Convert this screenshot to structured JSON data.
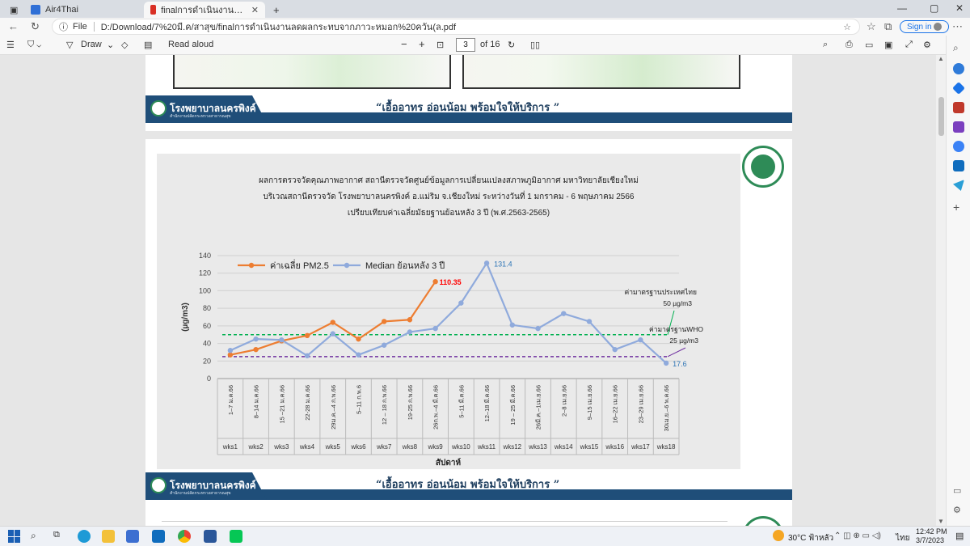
{
  "browser": {
    "tabs": [
      {
        "label": "Air4Thai",
        "active": false
      },
      {
        "label": "finalการดำเนินงานลดผลกระทบจากก",
        "active": true
      }
    ],
    "new_tab": "+",
    "address_prefix": "File",
    "url": "D:/Download/7%20มี.ค/สาสุข/finalการดำเนินงานลดผลกระทบจากภาวะหมอก%20ควัน(ล.pdf",
    "signin": "Sign in",
    "window_controls": [
      "—",
      "▢",
      "✕"
    ]
  },
  "pdf_toolbar": {
    "draw": "Draw",
    "read_aloud": "Read aloud",
    "zoom_out": "−",
    "zoom_in": "+",
    "page_current": "3",
    "page_total": "of 16"
  },
  "page_banner": {
    "hospital": "โรงพยาบาลนครพิงค์",
    "hospital_sub": "สำนักงานปลัดกระทรวงสาธารณสุข",
    "slogan": "“เอื้ออาทร อ่อนน้อม พร้อมใจให้บริการ ”"
  },
  "chart_titles": {
    "line1": "ผลการตรวจวัดคุณภาพอากาศ สถานีตรวจวัดศูนย์ข้อมูลการเปลี่ยนแปลงสภาพภูมิอากาศ มหาวิทยาลัยเชียงใหม่",
    "line2": "บริเวณสถานีตรวจวัด โรงพยาบาลนครพิงค์ อ.แม่ริม จ.เชียงใหม่ ระหว่างวันที่ 1 มกราคม - 6 พฤษภาคม 2566",
    "line3": "เปรียบเทียบค่าเฉลี่ยมัธยฐานย้อนหลัง 3 ปี (พ.ศ.2563-2565)"
  },
  "chart_data": {
    "type": "line",
    "ylabel": "(µg/m3)",
    "xlabel": "สัปดาห์",
    "ylim": [
      0,
      140
    ],
    "yticks": [
      0,
      20,
      40,
      60,
      80,
      100,
      120,
      140
    ],
    "grid": true,
    "legend_position": "top-left",
    "categories": [
      "1–7 ม.ค.66",
      "8–14 ม.ค.66",
      "15 –21 ม.ค.66",
      "22-28 ม.ค.66",
      "29ม.ค.–4 ก.พ.66",
      "5–11 ก.พ.6",
      "12 – 18 ก.พ.66",
      "19-25 ก.พ.66",
      "26ก.พ.–4 มี.ค.66",
      "5–11 มี.ค.66",
      "12–18 มี.ค.66",
      "19 – 25 มี.ค.66",
      "26มี.ค.–1เม.ย.66",
      "2–8 เม.ย.66",
      "9–15 เม.ย.66",
      "16–22 เม.ย.66",
      "23–29 เม.ย.66",
      "30เม.ย.–6 พ.ค.66"
    ],
    "weeks": [
      "wks1",
      "wks2",
      "wks3",
      "wks4",
      "wks5",
      "wks6",
      "wks7",
      "wks8",
      "wks9",
      "wks10",
      "wks11",
      "wks12",
      "wks13",
      "wks14",
      "wks15",
      "wks16",
      "wks17",
      "wks18"
    ],
    "series": [
      {
        "name": "ค่าเฉลี่ย PM2.5",
        "color": "#ed7d31",
        "values": [
          27,
          33,
          43,
          49,
          64,
          45,
          65,
          67,
          110.35,
          null,
          null,
          null,
          null,
          null,
          null,
          null,
          null,
          null
        ]
      },
      {
        "name": "Median ย้อนหลัง 3 ปี",
        "color": "#8faadc",
        "values": [
          32,
          45,
          44,
          26,
          51,
          27,
          38,
          53,
          57,
          86,
          131.4,
          61,
          57,
          74,
          65,
          33,
          44,
          17.6
        ]
      }
    ],
    "data_labels": [
      {
        "text": "110.35",
        "color": "#ff0000"
      },
      {
        "text": "131.4",
        "color": "#2e75b6"
      },
      {
        "text": "17.6",
        "color": "#2e75b6"
      }
    ],
    "reference_lines": [
      {
        "value": 50,
        "color": "#00b050",
        "label1": "ค่ามาตรฐานประเทศไทย",
        "label2": "50 µg/m3"
      },
      {
        "value": 25,
        "color": "#7030a0",
        "label1": "ค่ามาตรฐานWHO",
        "label2": "25 µg/m3"
      }
    ]
  },
  "taskbar": {
    "weather": "30°C ฟ้าหลัว",
    "lang": "ไทย",
    "time": "12:42 PM",
    "date": "3/7/2023"
  }
}
